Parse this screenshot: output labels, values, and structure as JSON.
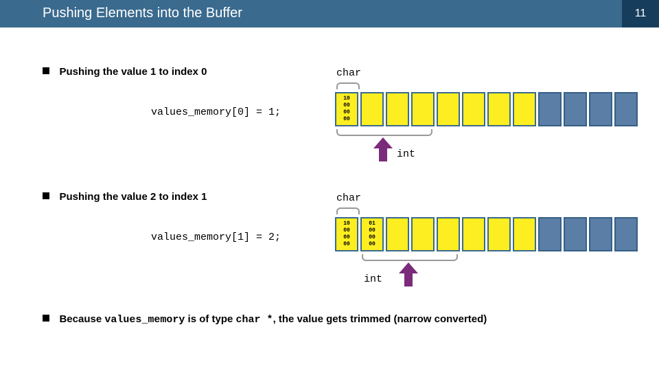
{
  "page_number": "11",
  "title": "Pushing Elements into the Buffer",
  "section1": {
    "bullet": "Pushing the value 1 to index 0",
    "code": "values_memory[0] = 1;",
    "char_label": "char",
    "int_label": "int",
    "cell0_bytes": [
      "10",
      "00",
      "00",
      "00"
    ]
  },
  "section2": {
    "bullet": "Pushing the value 2 to index 1",
    "code": "values_memory[1] = 2;",
    "char_label": "char",
    "int_label": "int",
    "cell0_bytes": [
      "10",
      "00",
      "00",
      "00"
    ],
    "cell1_bytes": [
      "01",
      "00",
      "00",
      "00"
    ]
  },
  "section3": {
    "prefix": "Because ",
    "ident": "values_memory",
    "mid": " is of type ",
    "type": "char *",
    "suffix": ", the value gets trimmed (narrow converted)"
  }
}
